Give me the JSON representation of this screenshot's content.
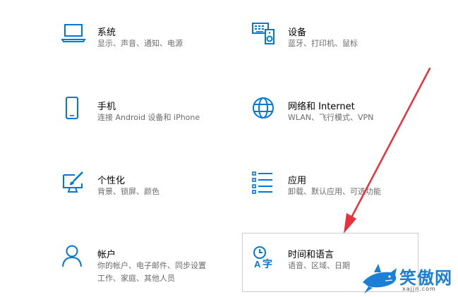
{
  "accent_color": "#0078d7",
  "tiles": [
    {
      "title": "系统",
      "desc": "显示、声音、通知、电源",
      "icon": "laptop-icon"
    },
    {
      "title": "设备",
      "desc": "蓝牙、打印机、鼠标",
      "icon": "keyboard-speaker-icon"
    },
    {
      "title": "手机",
      "desc": "连接 Android 设备和 iPhone",
      "icon": "phone-icon"
    },
    {
      "title": "网络和 Internet",
      "desc": "WLAN、飞行模式、VPN",
      "icon": "globe-icon"
    },
    {
      "title": "个性化",
      "desc": "背景、锁屏、颜色",
      "icon": "paint-brush-icon"
    },
    {
      "title": "应用",
      "desc": "卸载、默认应用、可选功能",
      "icon": "app-list-icon"
    },
    {
      "title": "帐户",
      "desc": [
        "你的帐户、电子邮件、同步设置",
        "工作、家庭、其他人员"
      ],
      "icon": "person-icon"
    },
    {
      "title": "时间和语言",
      "desc": "语音、区域、日期",
      "icon": "time-language-icon"
    }
  ],
  "annotation": {
    "arrow_color": "#e8313a",
    "icon": "red-arrow-icon"
  },
  "watermark": {
    "text": "笑傲网",
    "subtext": "xajjn.com",
    "icon": "shark-logo-icon"
  }
}
